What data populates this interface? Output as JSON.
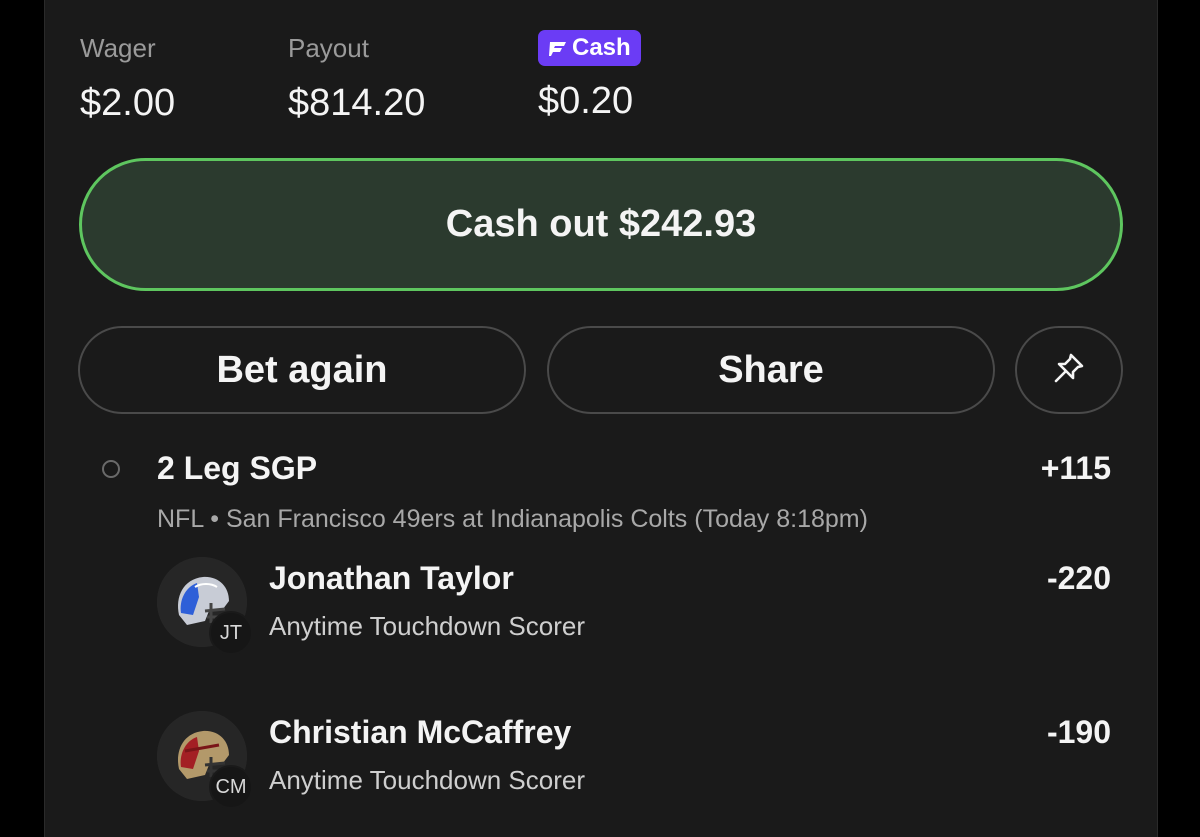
{
  "stats": {
    "wager_label": "Wager",
    "wager_value": "$2.00",
    "payout_label": "Payout",
    "payout_value": "$814.20",
    "cash_badge_label": "Cash",
    "cash_value": "$0.20"
  },
  "actions": {
    "cashout_label": "Cash out $242.93",
    "bet_again_label": "Bet again",
    "share_label": "Share",
    "pin_icon": "pin-icon"
  },
  "bet": {
    "title": "2 Leg SGP",
    "odds": "+115",
    "meta": "NFL • San Francisco 49ers at Indianapolis Colts (Today 8:18pm)",
    "legs": [
      {
        "player": "Jonathan Taylor",
        "initials": "JT",
        "market": "Anytime Touchdown Scorer",
        "odds": "-220",
        "helmet": "colts-helmet-icon"
      },
      {
        "player": "Christian McCaffrey",
        "initials": "CM",
        "market": "Anytime Touchdown Scorer",
        "odds": "-190",
        "helmet": "49ers-helmet-icon"
      }
    ]
  },
  "colors": {
    "cashout_border": "#5ec65f",
    "cashout_fill": "#2b3a2e",
    "cash_badge": "#6b3cf5",
    "card_bg": "#1a1a1a"
  }
}
